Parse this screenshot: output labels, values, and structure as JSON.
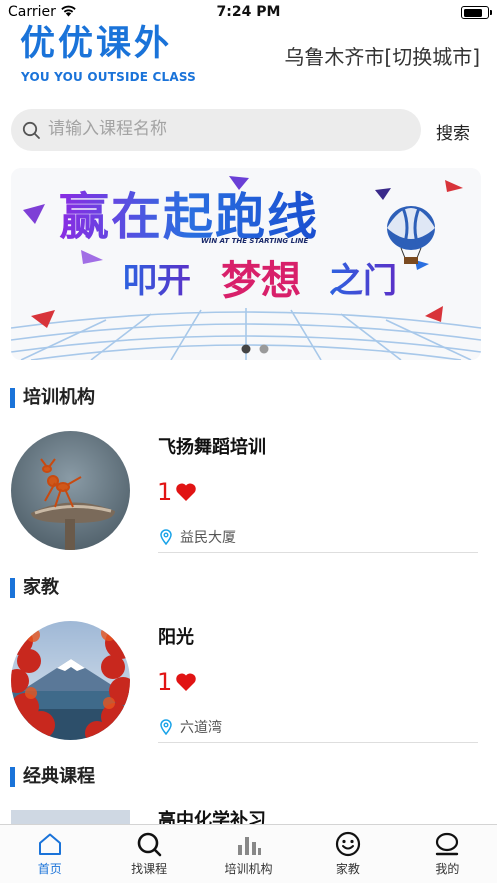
{
  "status_bar": {
    "carrier": "Carrier",
    "time": "7:24 PM",
    "battery_level": 0.85
  },
  "header": {
    "brand_cn": "优优课外",
    "brand_en": "YOU YOU OUTSIDE CLASS",
    "city": "乌鲁木齐市[切换城市]"
  },
  "search": {
    "placeholder": "请输入课程名称",
    "value": "",
    "button_label": "搜索"
  },
  "banner": {
    "line1": "赢在起跑线",
    "line_en": "WIN AT THE STARTING LINE",
    "line2_a": "叩开",
    "line2_b": "梦想",
    "line2_c": "之门",
    "page_count": 2,
    "active_page": 1
  },
  "sections": {
    "training": {
      "title": "培训机构",
      "item": {
        "name": "飞扬舞蹈培训",
        "likes": "1",
        "location": "益民大厦"
      }
    },
    "tutor": {
      "title": "家教",
      "item": {
        "name": "阳光",
        "likes": "1",
        "location": "六道湾"
      }
    },
    "classic": {
      "title": "经典课程",
      "item": {
        "name": "高中化学补习"
      }
    }
  },
  "tabbar": {
    "active": "home",
    "tabs": [
      {
        "id": "home",
        "label": "首页",
        "icon": "home-icon"
      },
      {
        "id": "find",
        "label": "找课程",
        "icon": "search-icon"
      },
      {
        "id": "org",
        "label": "培训机构",
        "icon": "bar-chart-icon"
      },
      {
        "id": "tutor",
        "label": "家教",
        "icon": "smiley-icon"
      },
      {
        "id": "mine",
        "label": "我的",
        "icon": "user-icon"
      }
    ]
  },
  "colors": {
    "accent": "#1a73d9",
    "heart": "#e11414"
  }
}
